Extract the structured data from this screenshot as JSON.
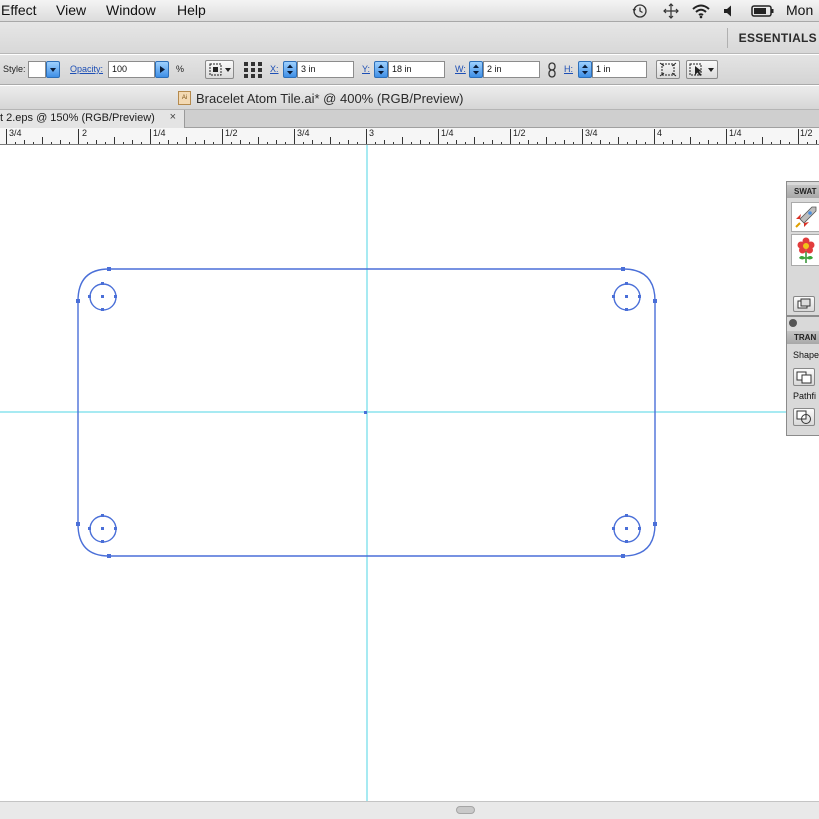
{
  "menubar": {
    "items": [
      "Effect",
      "View",
      "Window",
      "Help"
    ],
    "clock": "Mon"
  },
  "workspace": {
    "name": "ESSENTIALS"
  },
  "controlbar": {
    "style_label": "Style:",
    "opacity_label": "Opacity:",
    "opacity_value": "100",
    "percent": "%",
    "x_label": "X:",
    "x_value": "3 in",
    "y_label": "Y:",
    "y_value": "18 in",
    "w_label": "W:",
    "w_value": "2 in",
    "h_label": "H:",
    "h_value": "1 in"
  },
  "document": {
    "title": "Bracelet Atom Tile.ai* @ 400% (RGB/Preview)",
    "tab_label": "t 2.eps @ 150% (RGB/Preview)",
    "tab_close": "×"
  },
  "ruler": {
    "labels": [
      "3/4",
      "2",
      "1/4",
      "1/2",
      "3/4",
      "3",
      "1/4",
      "1/2",
      "3/4",
      "4",
      "1/4",
      "1/2"
    ]
  },
  "panels": {
    "swatches_title": "SWAT",
    "transform_title": "TRAN",
    "shape_label": "Shape",
    "pathfinder_label": "Pathfi"
  },
  "colors": {
    "guide": "#4fd6e6",
    "path": "#4a6fd8",
    "accent": "#1d4fb5"
  }
}
